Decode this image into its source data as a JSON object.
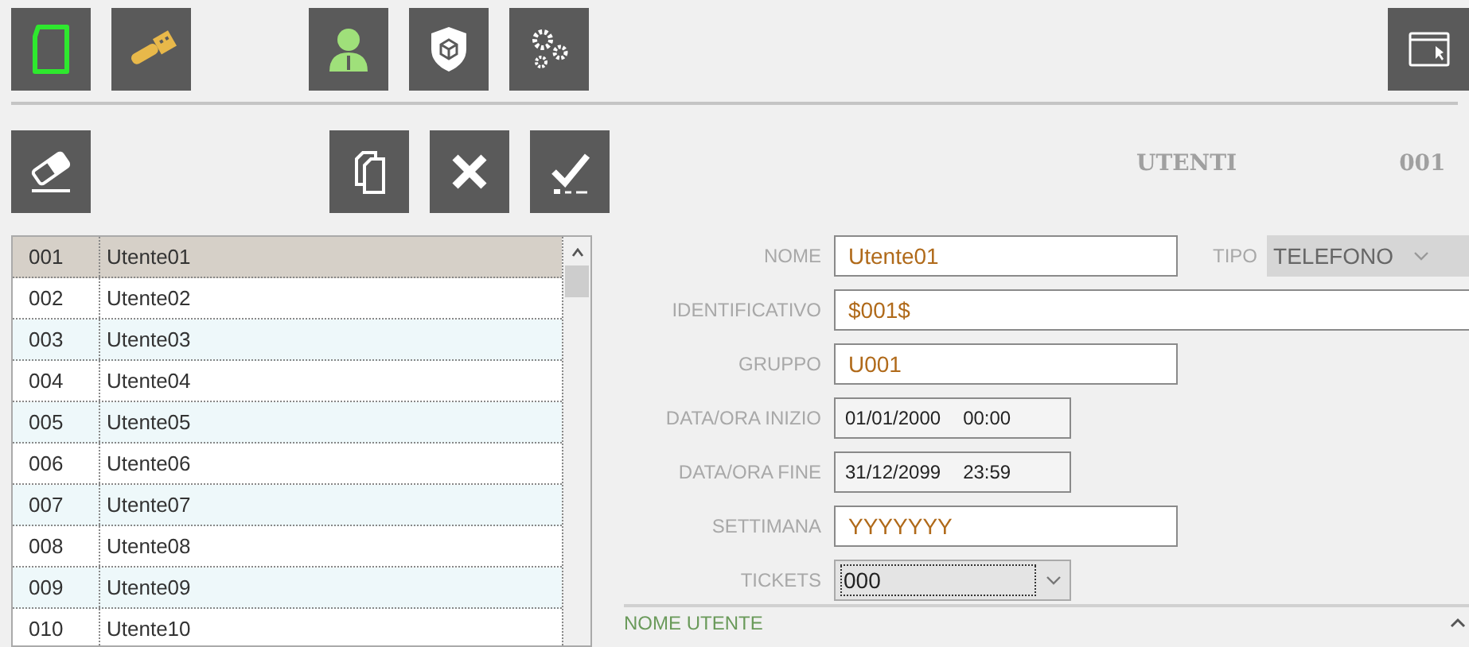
{
  "toolbar_top": [
    {
      "kind": "new-document"
    },
    {
      "kind": "usb"
    },
    {
      "kind": "user"
    },
    {
      "kind": "shield"
    },
    {
      "kind": "gears"
    }
  ],
  "toolbar_top_right": [
    {
      "kind": "window-cursor"
    }
  ],
  "toolbar_second": [
    {
      "kind": "eraser"
    },
    {
      "kind": "copy"
    },
    {
      "kind": "delete"
    },
    {
      "kind": "confirm"
    }
  ],
  "list": {
    "rows": [
      {
        "code": "001",
        "name": "Utente01",
        "selected": true
      },
      {
        "code": "002",
        "name": "Utente02",
        "selected": false
      },
      {
        "code": "003",
        "name": "Utente03",
        "selected": false
      },
      {
        "code": "004",
        "name": "Utente04",
        "selected": false
      },
      {
        "code": "005",
        "name": "Utente05",
        "selected": false
      },
      {
        "code": "006",
        "name": "Utente06",
        "selected": false
      },
      {
        "code": "007",
        "name": "Utente07",
        "selected": false
      },
      {
        "code": "008",
        "name": "Utente08",
        "selected": false
      },
      {
        "code": "009",
        "name": "Utente09",
        "selected": false
      },
      {
        "code": "010",
        "name": "Utente10",
        "selected": false
      }
    ]
  },
  "header": {
    "title": "UTENTI",
    "code": "001"
  },
  "form": {
    "nome": {
      "label": "NOME",
      "value": "Utente01"
    },
    "tipo": {
      "label": "TIPO",
      "value": "TELEFONO",
      "disabled": true
    },
    "identificativo": {
      "label": "IDENTIFICATIVO",
      "value": "$001$"
    },
    "gruppo": {
      "label": "GRUPPO",
      "value": "U001"
    },
    "inizio": {
      "label": "DATA/ORA INIZIO",
      "date": "01/01/2000",
      "time": "00:00"
    },
    "fine": {
      "label": "DATA/ORA FINE",
      "date": "31/12/2099",
      "time": "23:59"
    },
    "settimana": {
      "label": "SETTIMANA",
      "value": "YYYYYYY"
    },
    "tickets": {
      "label": "TICKETS",
      "value": "000"
    }
  },
  "section": {
    "title": "NOME UTENTE",
    "expanded": true
  }
}
